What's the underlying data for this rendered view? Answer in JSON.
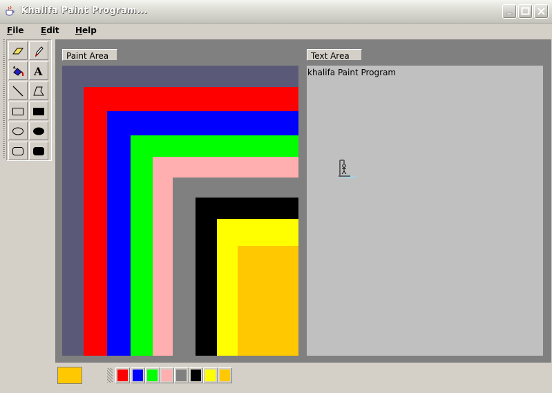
{
  "window": {
    "title": "Khalifa Paint Program..."
  },
  "menu": [
    {
      "mnemonic": "F",
      "rest": "ile"
    },
    {
      "mnemonic": "E",
      "rest": "dit"
    },
    {
      "mnemonic": "H",
      "rest": "elp"
    }
  ],
  "tools": [
    "eraser-icon",
    "pencil-icon",
    "fill-icon",
    "text-icon",
    "line-icon",
    "polygon-icon",
    "rectangle-icon",
    "filled-rectangle-icon",
    "oval-icon",
    "filled-oval-icon",
    "rounded-rectangle-icon",
    "filled-rounded-rectangle-icon"
  ],
  "paint_area": {
    "label": "Paint Area"
  },
  "text_area": {
    "label": "Text Area",
    "content": "khalifa Paint Program"
  },
  "colors": {
    "canvas_bg": "#5a5a78",
    "red": "#ff0000",
    "blue": "#0000ff",
    "green": "#00ff00",
    "pink": "#ffafaf",
    "gray": "#808080",
    "black": "#000000",
    "yellow": "#ffff00",
    "orange": "#ffc800"
  },
  "current_color": "#ffc800",
  "palette": [
    "#ff0000",
    "#0000ff",
    "#00ff00",
    "#ffafaf",
    "#808080",
    "#000000",
    "#ffff00",
    "#ffc800"
  ]
}
